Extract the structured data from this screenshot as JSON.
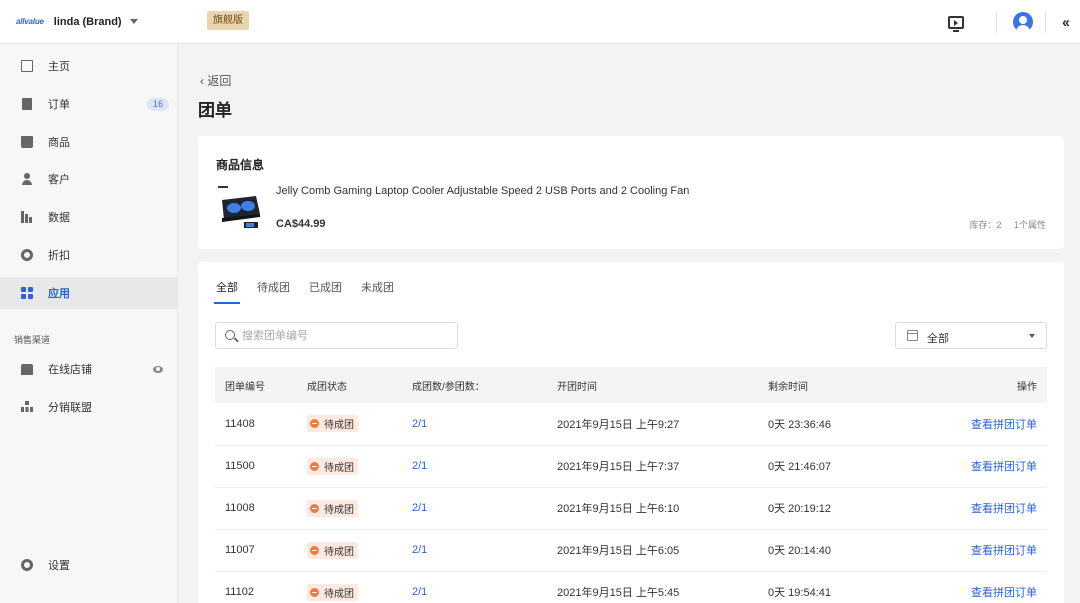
{
  "header": {
    "logo_text": "allvalue",
    "store_name": "linda (Brand)",
    "plan_badge": "旗舰版"
  },
  "sidebar": {
    "items": [
      {
        "label": "主页",
        "icon": "home-icon"
      },
      {
        "label": "订单",
        "icon": "order-icon",
        "badge": "16"
      },
      {
        "label": "商品",
        "icon": "product-icon"
      },
      {
        "label": "客户",
        "icon": "customer-icon"
      },
      {
        "label": "数据",
        "icon": "chart-icon"
      },
      {
        "label": "折扣",
        "icon": "discount-icon"
      },
      {
        "label": "应用",
        "icon": "apps-icon",
        "active": true
      }
    ],
    "section_label": "销售渠道",
    "channels": [
      {
        "label": "在线店铺",
        "icon": "store-icon"
      },
      {
        "label": "分销联盟",
        "icon": "affiliate-icon"
      }
    ],
    "settings_label": "设置"
  },
  "main": {
    "back_label": "返回",
    "title": "团单",
    "product_card": {
      "title": "商品信息",
      "name": "Jelly Comb Gaming Laptop Cooler Adjustable Speed 2 USB Ports and 2 Cooling Fan",
      "price": "CA$44.99",
      "stock": "库存：2",
      "attributes": "1个属性"
    },
    "tabs": [
      "全部",
      "待成团",
      "已成团",
      "未成团"
    ],
    "search": {
      "placeholder": "搜索团单编号",
      "value": ""
    },
    "date_filter": {
      "value": "全部"
    },
    "table": {
      "columns": [
        "团单编号",
        "成团状态",
        "成团数/参团数：",
        "开团时间",
        "剩余时间",
        "操作"
      ],
      "rows": [
        {
          "id": "11408",
          "status": "待成团",
          "count": "2/1",
          "opened": "2021年9月15日 上午9:27",
          "remaining": "0天 23:36:46",
          "action": "查看拼团订单"
        },
        {
          "id": "11500",
          "status": "待成团",
          "count": "2/1",
          "opened": "2021年9月15日 上午7:37",
          "remaining": "0天 21:46:07",
          "action": "查看拼团订单"
        },
        {
          "id": "11008",
          "status": "待成团",
          "count": "2/1",
          "opened": "2021年9月15日 上午6:10",
          "remaining": "0天 20:19:12",
          "action": "查看拼团订单"
        },
        {
          "id": "11007",
          "status": "待成团",
          "count": "2/1",
          "opened": "2021年9月15日 上午6:05",
          "remaining": "0天 20:14:40",
          "action": "查看拼团订单"
        },
        {
          "id": "11102",
          "status": "待成团",
          "count": "2/1",
          "opened": "2021年9月15日 上午5:45",
          "remaining": "0天 19:54:41",
          "action": "查看拼团订单"
        }
      ]
    }
  },
  "colors": {
    "accent": "#2a64d6",
    "status_pending": "#f07b3f",
    "badge_bg": "#e9d5ad"
  }
}
